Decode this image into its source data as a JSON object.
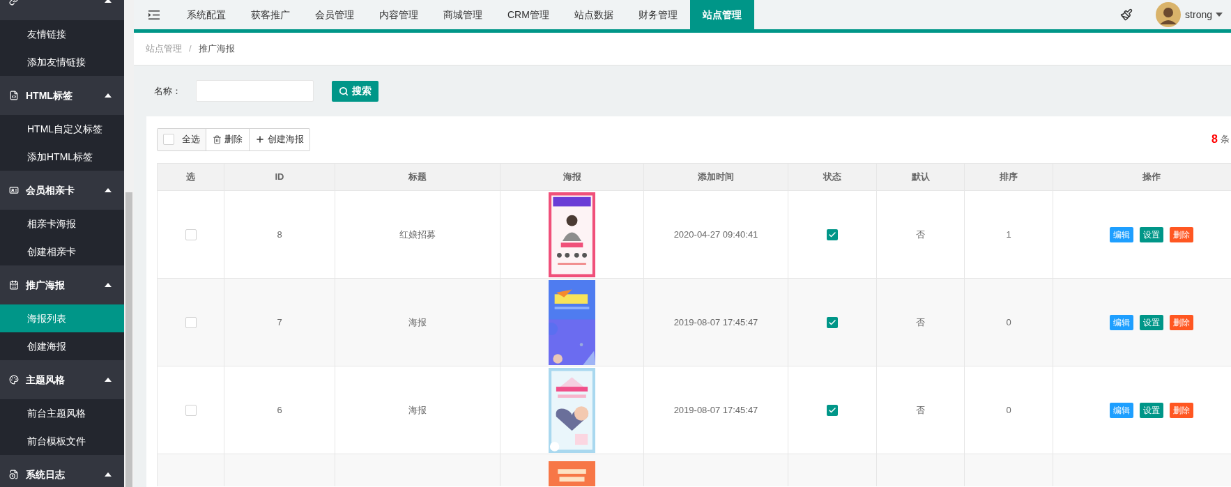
{
  "sidebar": {
    "groups": [
      {
        "kind": "link",
        "expanded": true,
        "children": [
          {
            "label": "友情链接",
            "selected": false
          },
          {
            "label": "添加友情链接",
            "selected": false
          }
        ]
      },
      {
        "kind": "code",
        "label": "HTML标签",
        "expanded": true,
        "children": [
          {
            "label": "HTML自定义标签",
            "selected": false
          },
          {
            "label": "添加HTML标签",
            "selected": false
          }
        ]
      },
      {
        "kind": "card",
        "label": "会员相亲卡",
        "expanded": true,
        "children": [
          {
            "label": "相亲卡海报",
            "selected": false
          },
          {
            "label": "创建相亲卡",
            "selected": false
          }
        ]
      },
      {
        "kind": "poster",
        "label": "推广海报",
        "expanded": true,
        "children": [
          {
            "label": "海报列表",
            "selected": true
          },
          {
            "label": "创建海报",
            "selected": false
          }
        ]
      },
      {
        "kind": "palette",
        "label": "主题风格",
        "expanded": true,
        "children": [
          {
            "label": "前台主题风格",
            "selected": false
          },
          {
            "label": "前台模板文件",
            "selected": false
          }
        ]
      },
      {
        "kind": "log",
        "label": "系统日志",
        "expanded": true
      }
    ]
  },
  "nav": {
    "tabs": [
      {
        "label": "系统配置",
        "selected": false
      },
      {
        "label": "获客推广",
        "selected": false
      },
      {
        "label": "会员管理",
        "selected": false
      },
      {
        "label": "内容管理",
        "selected": false
      },
      {
        "label": "商城管理",
        "selected": false
      },
      {
        "label": "CRM管理",
        "selected": false
      },
      {
        "label": "站点数据",
        "selected": false
      },
      {
        "label": "财务管理",
        "selected": false
      },
      {
        "label": "站点管理",
        "selected": true
      }
    ],
    "user": {
      "name": "strong"
    }
  },
  "breadcrumb": {
    "separator": "/",
    "items": [
      "站点管理",
      "推广海报"
    ]
  },
  "search": {
    "label": "名称：",
    "button": "搜索"
  },
  "toolbar": {
    "select_all": {
      "label": "全选",
      "checked": false
    },
    "delete": "删除",
    "create": "创建海报"
  },
  "count": {
    "number": "8",
    "unit": "条"
  },
  "table": {
    "columns": [
      "选",
      "ID",
      "标题",
      "海报",
      "添加时间",
      "状态",
      "默认",
      "排序",
      "操作"
    ],
    "rows": [
      {
        "checked": false,
        "id": "8",
        "title": "红娘招募",
        "poster": {
          "kind": "picture"
        },
        "time": "2020-04-27 09:40:41",
        "status": true,
        "default": "否",
        "sort": "1",
        "actions": [
          {
            "kind": "edit",
            "label": "编辑"
          },
          {
            "kind": "settings",
            "label": "设置"
          },
          {
            "kind": "delete",
            "label": "删除"
          }
        ]
      },
      {
        "checked": false,
        "id": "7",
        "title": "海报",
        "poster": {
          "kind": "picture"
        },
        "time": "2019-08-07 17:45:47",
        "status": true,
        "default": "否",
        "sort": "0",
        "actions": [
          {
            "kind": "edit",
            "label": "编辑"
          },
          {
            "kind": "settings",
            "label": "设置"
          },
          {
            "kind": "delete",
            "label": "删除"
          }
        ]
      },
      {
        "checked": false,
        "id": "6",
        "title": "海报",
        "poster": {
          "kind": "picture"
        },
        "time": "2019-08-07 17:45:47",
        "status": true,
        "default": "否",
        "sort": "0",
        "actions": [
          {
            "kind": "edit",
            "label": "编辑"
          },
          {
            "kind": "settings",
            "label": "设置"
          },
          {
            "kind": "delete",
            "label": "删除"
          }
        ]
      },
      {
        "poster": {
          "kind": "picture"
        }
      }
    ]
  }
}
